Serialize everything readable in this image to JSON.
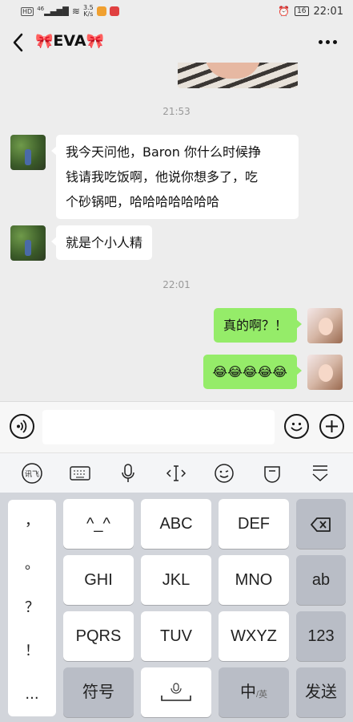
{
  "status_bar": {
    "badge": "HD",
    "net_type": "46",
    "net_speed": "3.5",
    "net_unit": "K/s",
    "battery": "16",
    "time": "22:01"
  },
  "header": {
    "title": "EVA",
    "bow_left": "🎀",
    "bow_right": "🎀"
  },
  "messages": [
    {
      "time": "21:53"
    },
    {
      "from": "them",
      "text_line1": "我今天问他，Baron 你什么时候挣",
      "text_line2": "钱请我吃饭啊，他说你想多了，吃",
      "text_line3": "个砂锅吧，哈哈哈哈哈哈哈"
    },
    {
      "from": "them",
      "text": "就是个小人精"
    },
    {
      "time": "22:01"
    },
    {
      "from": "me",
      "text": "真的啊？！"
    },
    {
      "from": "me",
      "text": "😂😂😂😂😂"
    }
  ],
  "input": {
    "value": "",
    "placeholder": ""
  },
  "keyboard": {
    "punctuation": [
      "，",
      "。",
      "？",
      "！",
      "..."
    ],
    "rows": [
      [
        "^_^",
        "ABC",
        "DEF"
      ],
      [
        "GHI",
        "JKL",
        "MNO"
      ],
      [
        "PQRS",
        "TUV",
        "WXYZ"
      ]
    ],
    "ab": "ab",
    "num": "123",
    "symbols": "符号",
    "lang_main": "中",
    "lang_sub": "/英",
    "send": "发送"
  },
  "colors": {
    "outgoing_bubble": "#95ec69",
    "incoming_bubble": "#ffffff",
    "chat_bg": "#ededed"
  }
}
